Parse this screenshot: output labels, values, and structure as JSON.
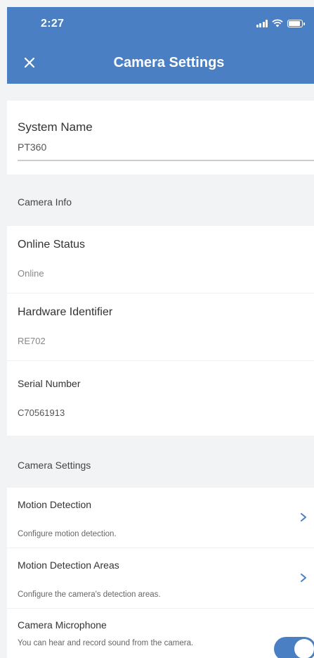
{
  "status_bar": {
    "time": "2:27",
    "battery_level": 0.9
  },
  "nav": {
    "title": "Camera Settings",
    "close_icon": "close-icon"
  },
  "system_name": {
    "label": "System Name",
    "value": "PT360"
  },
  "camera_info": {
    "header": "Camera Info",
    "items": [
      {
        "label": "Online Status",
        "value": "Online"
      },
      {
        "label": "Hardware Identifier",
        "value": "RE702"
      },
      {
        "label": "Serial Number",
        "value": "C70561913"
      }
    ]
  },
  "camera_settings": {
    "header": "Camera Settings",
    "items": [
      {
        "label": "Motion Detection",
        "description": "Configure motion detection."
      },
      {
        "label": "Motion Detection Areas",
        "description": "Configure the camera's detection areas."
      }
    ],
    "microphone": {
      "label": "Camera Microphone",
      "description": "You can hear and record sound from the camera.",
      "enabled": true
    }
  },
  "colors": {
    "accent": "#4a7fc3",
    "background": "#f2f3f5"
  }
}
